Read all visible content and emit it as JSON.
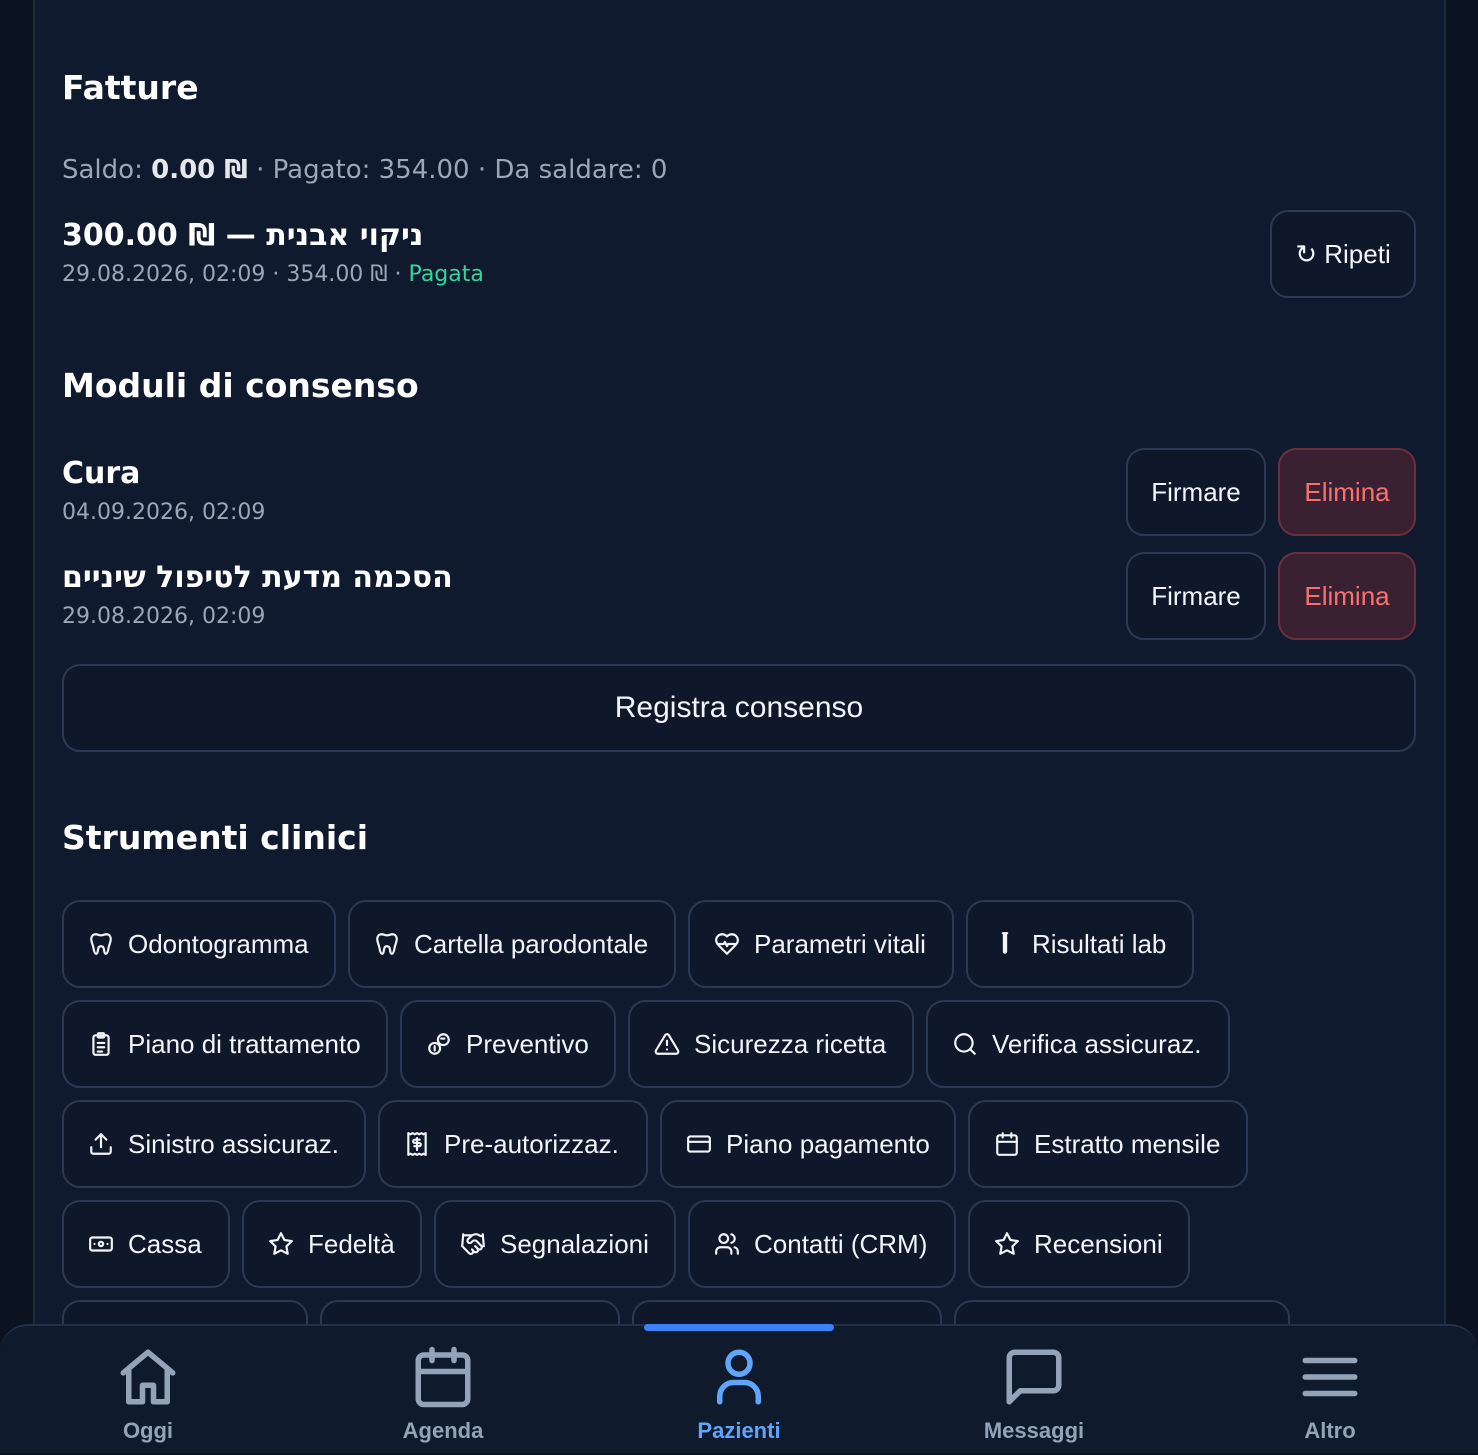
{
  "invoices": {
    "heading": "Fatture",
    "summary": {
      "balance_label": "Saldo:",
      "balance_value": "0.00 ₪",
      "paid_label": "· Pagato: 354.00",
      "due_label": "· Da saldare: 0"
    },
    "item": {
      "title": "300.00 ₪ — ניקוי אבנית",
      "meta": "29.08.2026, 02:09 · 354.00 ₪ ·",
      "status": "Pagata"
    },
    "repeat_button": "↻ Ripeti"
  },
  "consents": {
    "heading": "Moduli di consenso",
    "items": [
      {
        "title": "Cura",
        "date": "04.09.2026, 02:09",
        "sign": "Firmare",
        "delete": "Elimina"
      },
      {
        "title": "הסכמה מדעת לטיפול שיניים",
        "date": "29.08.2026, 02:09",
        "sign": "Firmare",
        "delete": "Elimina"
      }
    ],
    "register_button": "Registra consenso"
  },
  "tools": {
    "heading": "Strumenti clinici",
    "items": [
      {
        "label": "Odontogramma",
        "icon": "tooth-icon"
      },
      {
        "label": "Cartella parodontale",
        "icon": "tooth-icon"
      },
      {
        "label": "Parametri vitali",
        "icon": "heart-pulse-icon"
      },
      {
        "label": "Risultati lab",
        "icon": "test-tube-icon"
      },
      {
        "label": "Piano di trattamento",
        "icon": "clipboard-icon"
      },
      {
        "label": "Preventivo",
        "icon": "coins-icon"
      },
      {
        "label": "Sicurezza ricetta",
        "icon": "warning-icon"
      },
      {
        "label": "Verifica assicuraz.",
        "icon": "search-icon"
      },
      {
        "label": "Sinistro assicuraz.",
        "icon": "upload-icon"
      },
      {
        "label": "Pre-autorizzaz.",
        "icon": "receipt-icon"
      },
      {
        "label": "Piano pagamento",
        "icon": "credit-card-icon"
      },
      {
        "label": "Estratto mensile",
        "icon": "calendar-icon"
      },
      {
        "label": "Cassa",
        "icon": "banknote-icon"
      },
      {
        "label": "Fedeltà",
        "icon": "star-icon"
      },
      {
        "label": "Segnalazioni",
        "icon": "handshake-icon"
      },
      {
        "label": "Contatti (CRM)",
        "icon": "users-icon"
      },
      {
        "label": "Recensioni",
        "icon": "star-icon"
      }
    ]
  },
  "bottom_nav": {
    "active": "Pazienti",
    "items": [
      {
        "label": "Oggi",
        "icon": "home-icon"
      },
      {
        "label": "Agenda",
        "icon": "calendar-icon"
      },
      {
        "label": "Pazienti",
        "icon": "user-icon"
      },
      {
        "label": "Messaggi",
        "icon": "message-icon"
      },
      {
        "label": "Altro",
        "icon": "menu-icon"
      }
    ]
  },
  "colors": {
    "background": "#101a2e",
    "accent": "#3b82f6",
    "success": "#34d399",
    "danger": "#f87171"
  }
}
